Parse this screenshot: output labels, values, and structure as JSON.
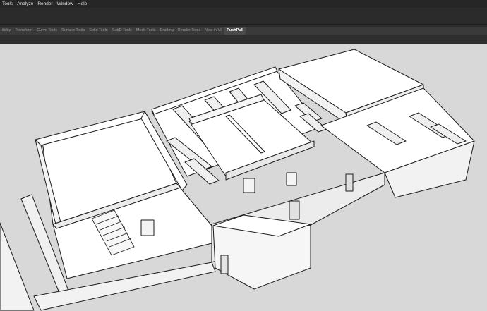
{
  "menubar": {
    "items": [
      "Tools",
      "Analyze",
      "Render",
      "Window",
      "Help"
    ]
  },
  "tabs": {
    "items": [
      {
        "label": "ibility",
        "active": false
      },
      {
        "label": "Transform",
        "active": false
      },
      {
        "label": "Curve Tools",
        "active": false
      },
      {
        "label": "Surface Tools",
        "active": false
      },
      {
        "label": "Solid Tools",
        "active": false
      },
      {
        "label": "SubD Tools",
        "active": false
      },
      {
        "label": "Mesh Tools",
        "active": false
      },
      {
        "label": "Drafting",
        "active": false
      },
      {
        "label": "Render Tools",
        "active": false
      },
      {
        "label": "New in V8",
        "active": false
      },
      {
        "label": "PushPull",
        "active": true
      }
    ]
  },
  "viewport": {
    "content": "isometric-building-model",
    "background": "#d8d8d8"
  }
}
